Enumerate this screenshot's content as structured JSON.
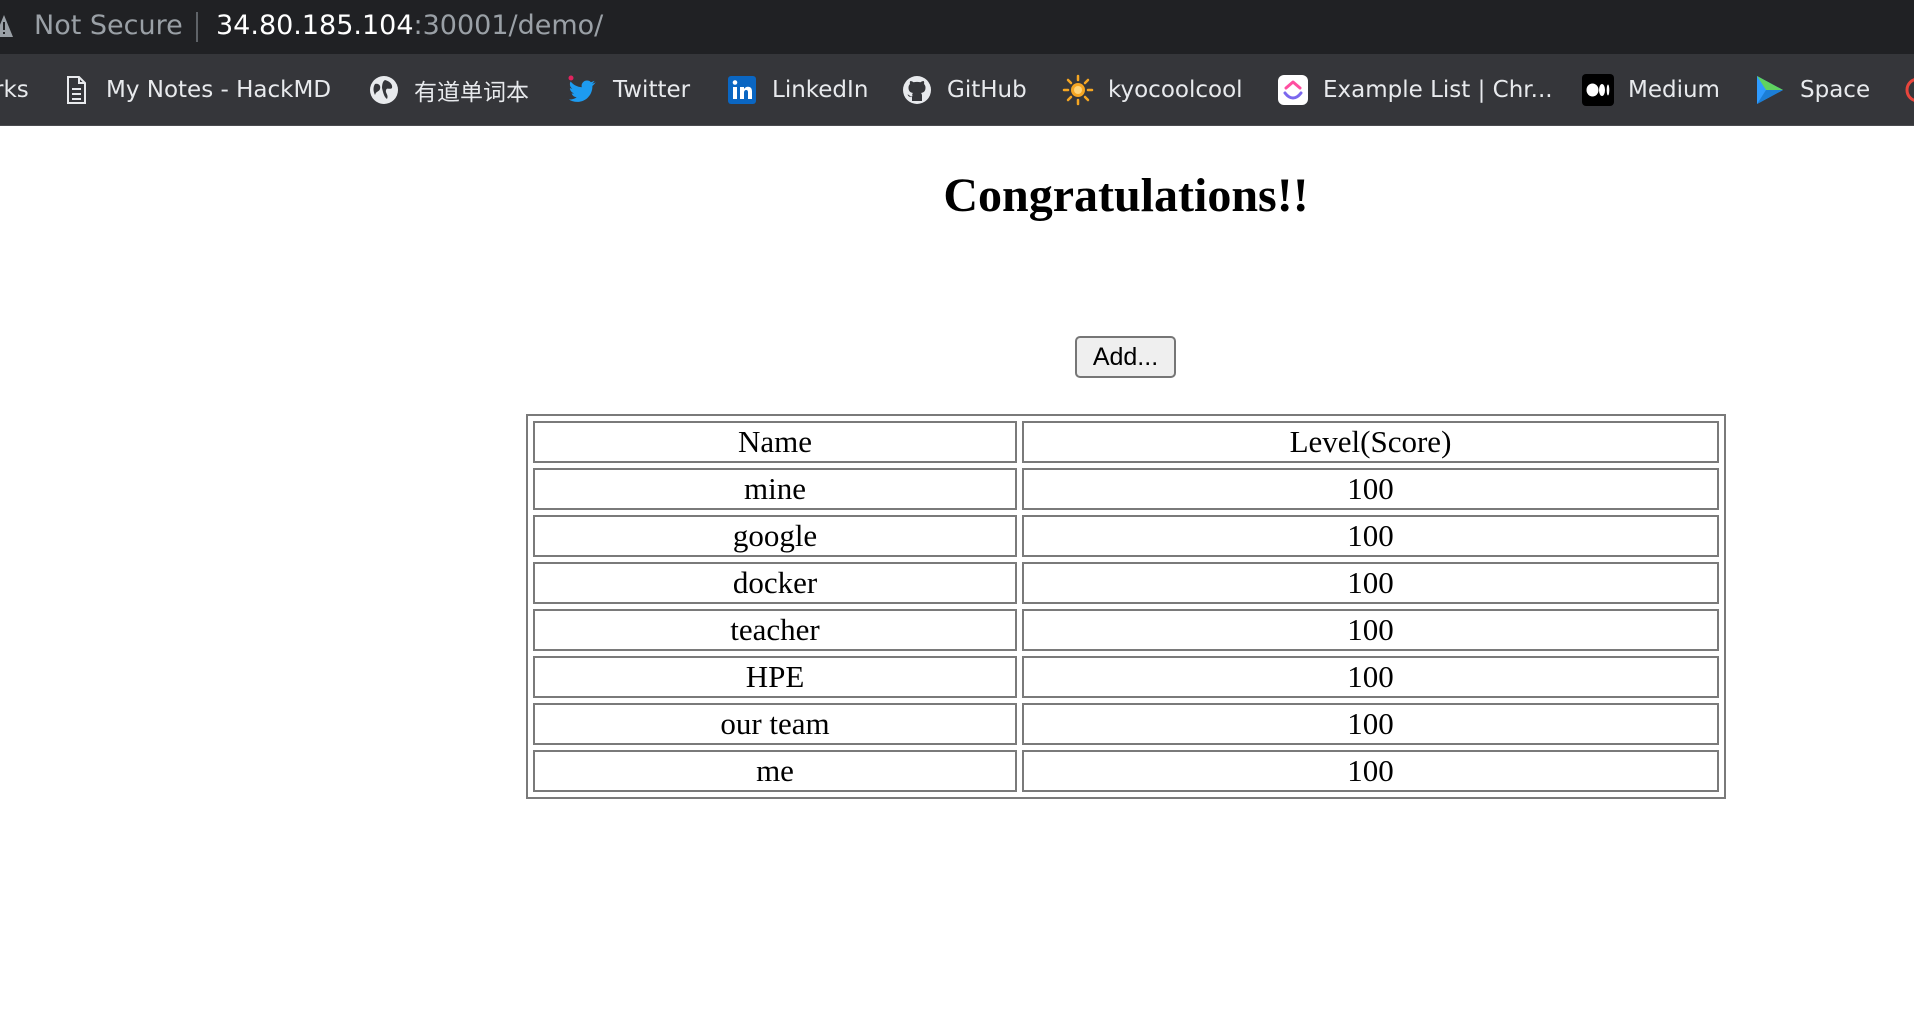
{
  "address_bar": {
    "security_label": "Not Secure",
    "url_host": "34.80.185.104",
    "url_path": ":30001/demo/"
  },
  "bookmarks": [
    {
      "label": "rks",
      "icon": "bookmarks-folder-cutoff"
    },
    {
      "label": "My Notes - HackMD",
      "icon": "document-icon"
    },
    {
      "label": "有道单词本",
      "icon": "globe-icon"
    },
    {
      "label": "Twitter",
      "icon": "twitter-bird-icon"
    },
    {
      "label": "LinkedIn",
      "icon": "linkedin-icon"
    },
    {
      "label": "GitHub",
      "icon": "github-icon"
    },
    {
      "label": "kyocoolcool",
      "icon": "sun-icon"
    },
    {
      "label": "Example List | Chr...",
      "icon": "clickup-icon"
    },
    {
      "label": "Medium",
      "icon": "medium-icon"
    },
    {
      "label": "Space",
      "icon": "space-icon"
    }
  ],
  "page": {
    "title": "Congratulations!!",
    "add_button_label": "Add..."
  },
  "table": {
    "headers": [
      "Name",
      "Level(Score)"
    ],
    "rows": [
      [
        "mine",
        "100"
      ],
      [
        "google",
        "100"
      ],
      [
        "docker",
        "100"
      ],
      [
        "teacher",
        "100"
      ],
      [
        "HPE",
        "100"
      ],
      [
        "our team",
        "100"
      ],
      [
        "me",
        "100"
      ]
    ]
  },
  "colors": {
    "address_bar_bg": "#202124",
    "bookmarks_bar_bg": "#35363a",
    "twitter_blue": "#1d9bf0",
    "linkedin_blue": "#0a66c2"
  }
}
